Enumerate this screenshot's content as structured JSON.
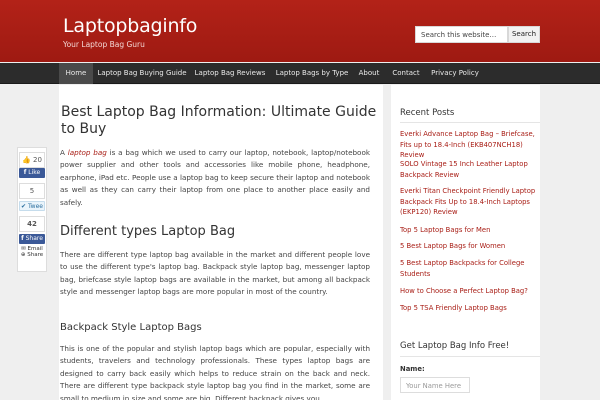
{
  "header": {
    "title": "Laptopbaginfo",
    "tagline": "Your Laptop Bag Guru",
    "search_placeholder": "Search this website…",
    "search_button": "Search"
  },
  "nav": {
    "items": [
      "Home",
      "Laptop Bag Buying Guide",
      "Laptop Bag Reviews",
      "Laptop Bags by Type",
      "About",
      "Contact",
      "Privacy Policy"
    ]
  },
  "share": {
    "like_count": "20",
    "like_label": "Like",
    "tweet_count": "5",
    "tweet_label": "Twee",
    "share_count": "42",
    "share_label": "Share",
    "email_label": "Email",
    "share2_label": "Share"
  },
  "post": {
    "title": "Best Laptop Bag Information: Ultimate Guide to Buy",
    "intro_lead": "A",
    "intro_keyword": "laptop bag",
    "intro_rest": "is a bag which we used to carry our laptop, notebook, laptop/notebook power supplier and other tools and accessories like mobile phone, headphone, earphone, iPad etc. People use a laptop bag to keep secure their laptop and notebook as well as they can carry their laptop from one place to another place easily and safely.",
    "h2": "Different types Laptop Bag",
    "para2": "There are different type laptop bag available in the market and different people love to use the different type's laptop bag. Backpack style laptop bag, messenger laptop bag, briefcase style laptop bags are available in the market, but among all backpack style and messenger laptop bags are more popular in most of the country.",
    "h3": "Backpack Style Laptop Bags",
    "para3": "This is one of the popular and stylish laptop bags which are popular, especially with students, travelers and technology professionals. These types laptop bags are designed to carry back easily which helps to reduce strain on the back and neck. There are different type backpack style laptop bag you find in the market, some are small to medium in size and some are big. Different backpack gives you"
  },
  "sidebar": {
    "recent_title": "Recent Posts",
    "recent_posts": [
      "Everki Advance Laptop Bag – Briefcase, Fits up to 18.4-Inch (EKB407NCH18) Review",
      "SOLO Vintage 15 Inch Leather Laptop Backpack Review",
      "Everki Titan Checkpoint Friendly Laptop Backpack Fits Up to 18.4-Inch Laptops (EKP120) Review",
      "Top 5 Laptop Bags for Men",
      "5 Best Laptop Bags for Women",
      "5 Best Laptop Backpacks for College Students",
      "How to Choose a Perfect Laptop Bag?",
      "Top 5 TSA Friendly Laptop Bags"
    ],
    "newsletter_title": "Get Laptop Bag Info Free!",
    "name_label": "Name:",
    "name_placeholder": "Your Name Here"
  },
  "colors": {
    "header_red": "#a81d15",
    "nav_dark": "#2c2c2c",
    "link_red": "#a81d15"
  }
}
